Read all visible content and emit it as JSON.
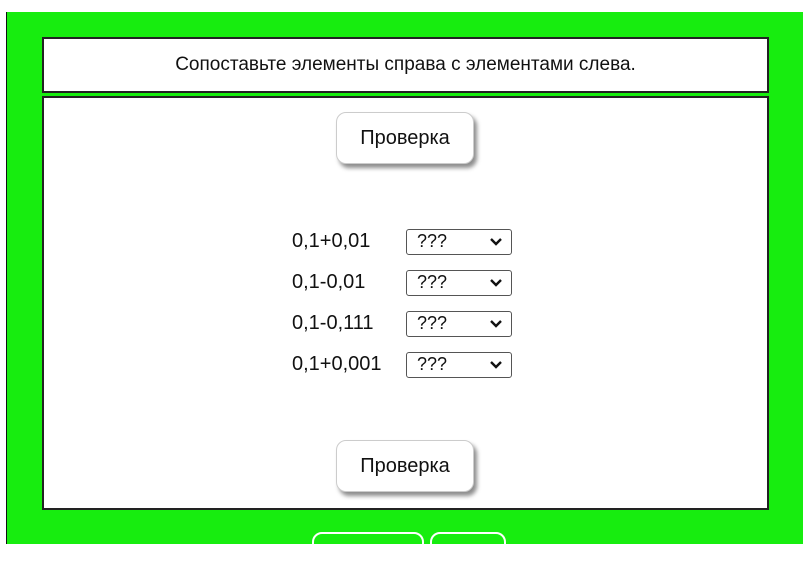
{
  "header": {
    "instructions": "Сопоставьте элементы справа с элементами слева."
  },
  "buttons": {
    "check_label": "Проверка"
  },
  "items": [
    {
      "expression": "0,1+0,01",
      "selected": "???"
    },
    {
      "expression": "0,1-0,01",
      "selected": "???"
    },
    {
      "expression": "0,1-0,111",
      "selected": "???"
    },
    {
      "expression": "0,1+0,001",
      "selected": "???"
    }
  ],
  "colors": {
    "background_panel": "#17ed0f",
    "box_border": "#222222",
    "box_background": "#ffffff"
  }
}
